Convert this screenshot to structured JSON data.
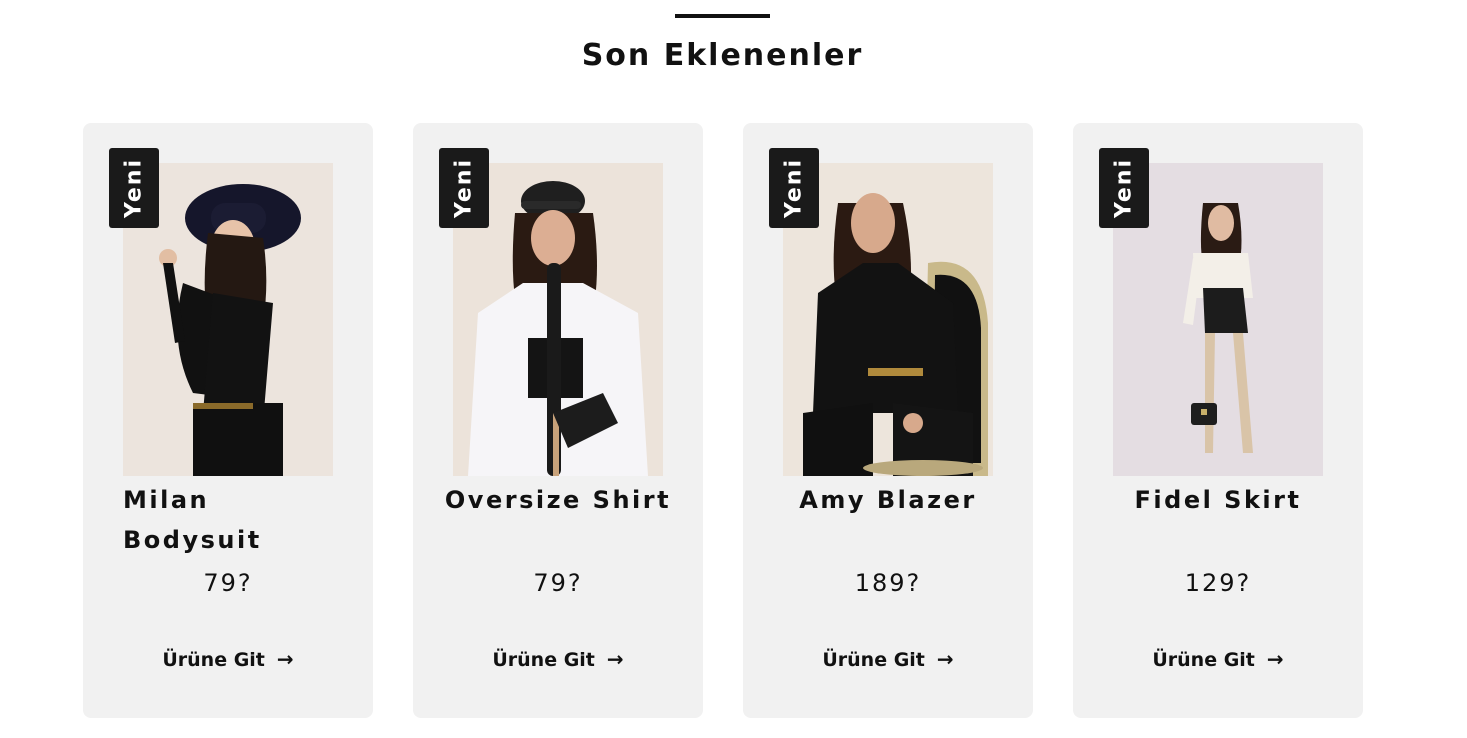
{
  "section": {
    "title": "Son Eklenenler"
  },
  "products": [
    {
      "badge": "Yeni",
      "name": "Milan Bodysuit",
      "price": "79?",
      "cta": "Ürüne Git",
      "arrow": "→"
    },
    {
      "badge": "Yeni",
      "name": "Oversize Shirt",
      "price": "79?",
      "cta": "Ürüne Git",
      "arrow": "→"
    },
    {
      "badge": "Yeni",
      "name": "Amy Blazer",
      "price": "189?",
      "cta": "Ürüne Git",
      "arrow": "→"
    },
    {
      "badge": "Yeni",
      "name": "Fidel Skirt",
      "price": "129?",
      "cta": "Ürüne Git",
      "arrow": "→"
    }
  ],
  "colors": {
    "card_bg": "#f1f1f1",
    "badge_bg": "#1a1a1a",
    "text": "#111111"
  },
  "icons": {
    "cta": "arrow-right-icon"
  }
}
